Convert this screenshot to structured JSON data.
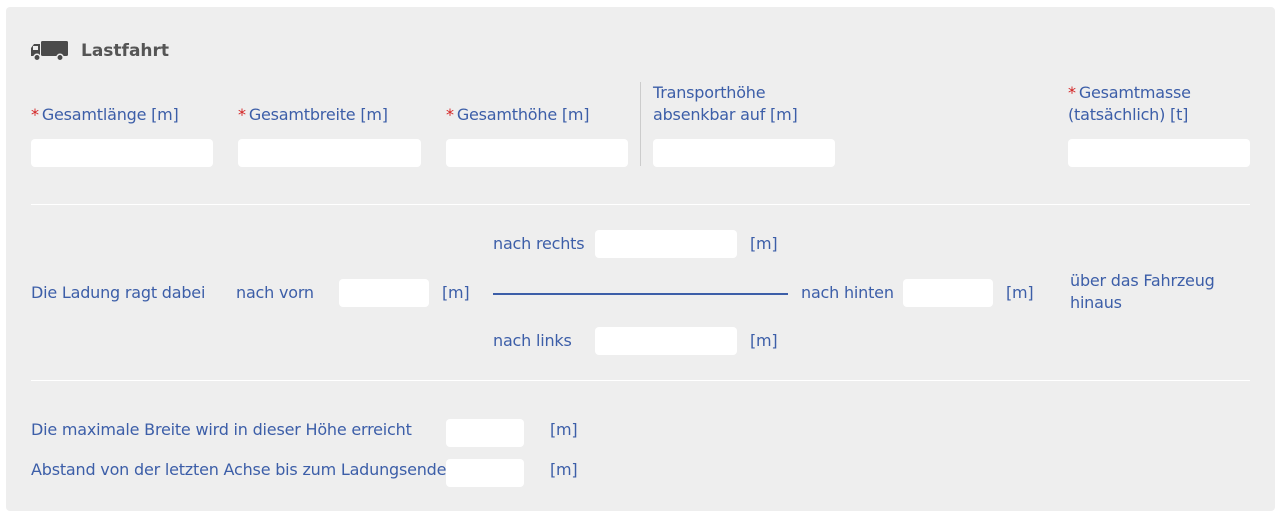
{
  "section": {
    "title": "Lastfahrt",
    "icon": "truck-icon"
  },
  "required_marker": "*",
  "dimensions": {
    "length_label": "Gesamtlänge [m]",
    "width_label": "Gesamtbreite [m]",
    "height_label": "Gesamthöhe [m]",
    "transport_height_line1": "Transporthöhe",
    "transport_height_line2": "absenkbar auf [m]",
    "mass_line1": "Gesamtmasse",
    "mass_line2": "(tatsächlich) [t]",
    "length_value": "",
    "width_value": "",
    "height_value": "",
    "transport_height_value": "",
    "mass_value": ""
  },
  "overhang": {
    "intro": "Die Ladung ragt dabei",
    "front_label": "nach vorn",
    "right_label": "nach rechts",
    "left_label": "nach links",
    "rear_label": "nach hinten",
    "unit": "[m]",
    "suffix_line1": "über das Fahrzeug",
    "suffix_line2": "hinaus",
    "front_value": "",
    "right_value": "",
    "left_value": "",
    "rear_value": ""
  },
  "extra": {
    "max_width_height_label": "Die maximale Breite wird in dieser Höhe erreicht",
    "last_axle_distance_label": "Abstand von der letzten Achse bis zum Ladungsende",
    "unit": "[m]",
    "max_width_height_value": "",
    "last_axle_distance_value": ""
  },
  "colors": {
    "label": "#3c5ea8",
    "required": "#d32020",
    "panel": "#eeeeee"
  }
}
